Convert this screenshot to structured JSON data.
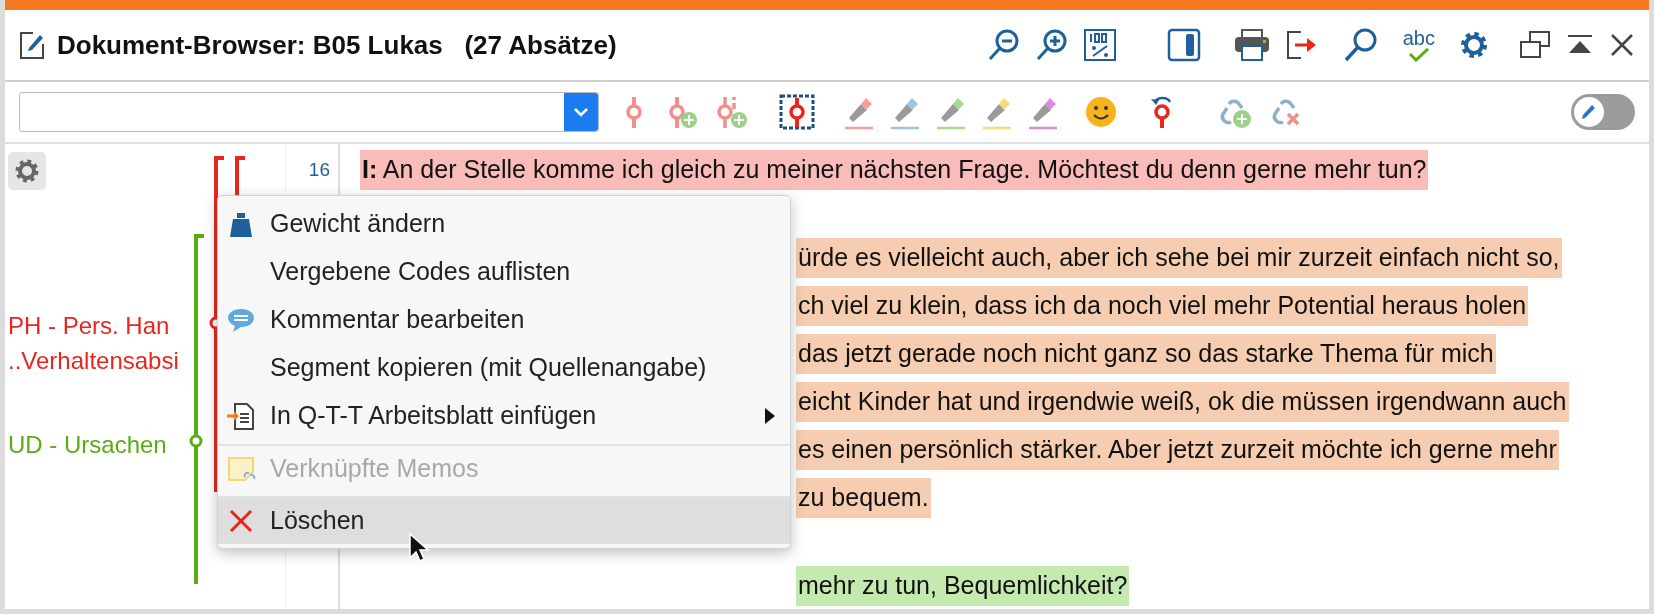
{
  "window": {
    "title": "Dokument-Browser: B05 Lukas   (27 Absätze)"
  },
  "highlighters": [
    {
      "color": "#f4a09a"
    },
    {
      "color": "#9fc4de"
    },
    {
      "color": "#a8d88c"
    },
    {
      "color": "#fcd77a"
    },
    {
      "color": "#dd8ad8"
    }
  ],
  "edit_mode": {
    "on": false
  },
  "spellcheck": {
    "label": "abc"
  },
  "codes": [
    {
      "label": "PH - Pers. Han",
      "color": "#e8261c"
    },
    {
      "label": "..Verhaltensabsi",
      "color": "#e8261c"
    },
    {
      "label": "UD - Ursachen",
      "color": "#5aac14"
    }
  ],
  "paragraphs": [
    {
      "number": "16",
      "lines": [
        {
          "kind": "full",
          "text": "**I:** An der Stelle komme ich gleich zu meiner nächsten Frage. Möchtest du denn gerne mehr tun?",
          "color": "#f9bcb8"
        }
      ]
    },
    {
      "lines": [
        {
          "kind": "tail",
          "text": "ürde es vielleicht auch, aber ich sehe bei mir zurzeit einfach nicht so,",
          "color": "#f6cdb0"
        },
        {
          "kind": "tail",
          "text": "ch viel zu klein, dass ich da noch viel mehr Potential heraus holen",
          "color": "#f6cdb0"
        },
        {
          "kind": "tail",
          "text": "das jetzt gerade noch nicht ganz so das starke Thema für mich",
          "color": "#f6cdb0"
        },
        {
          "kind": "tail",
          "text": "eicht Kinder hat und irgendwie weiß, ok die müssen irgendwann auch",
          "color": "#f6cdb0"
        },
        {
          "kind": "tail",
          "text": "es einen persönlich stärker. Aber jetzt zurzeit möchte ich gerne mehr",
          "color": "#f6cdb0"
        },
        {
          "kind": "tail",
          "text": "zu bequem.",
          "color": "#f6cdb0"
        }
      ]
    },
    {
      "lines": [
        {
          "kind": "tail",
          "text": "mehr zu tun, Bequemlichkeit?",
          "color": "#c5eab0"
        }
      ]
    }
  ],
  "context_menu": {
    "items": [
      {
        "label": "Gewicht ändern",
        "disabled": false,
        "selected": false,
        "submenu": false,
        "separator_before": false
      },
      {
        "label": "Vergebene Codes auflisten",
        "disabled": false,
        "selected": false,
        "submenu": false,
        "separator_before": false
      },
      {
        "label": "Kommentar bearbeiten",
        "disabled": false,
        "selected": false,
        "submenu": false,
        "separator_before": false
      },
      {
        "label": "Segment kopieren (mit Quellenangabe)",
        "disabled": false,
        "selected": false,
        "submenu": false,
        "separator_before": false
      },
      {
        "label": "In Q-T-T Arbeitsblatt einfügen",
        "disabled": false,
        "selected": false,
        "submenu": true,
        "separator_before": false
      },
      {
        "label": "Verknüpfte Memos",
        "disabled": true,
        "selected": false,
        "submenu": false,
        "separator_before": true
      },
      {
        "label": "Löschen",
        "disabled": false,
        "selected": true,
        "submenu": false,
        "separator_before": true
      }
    ]
  }
}
